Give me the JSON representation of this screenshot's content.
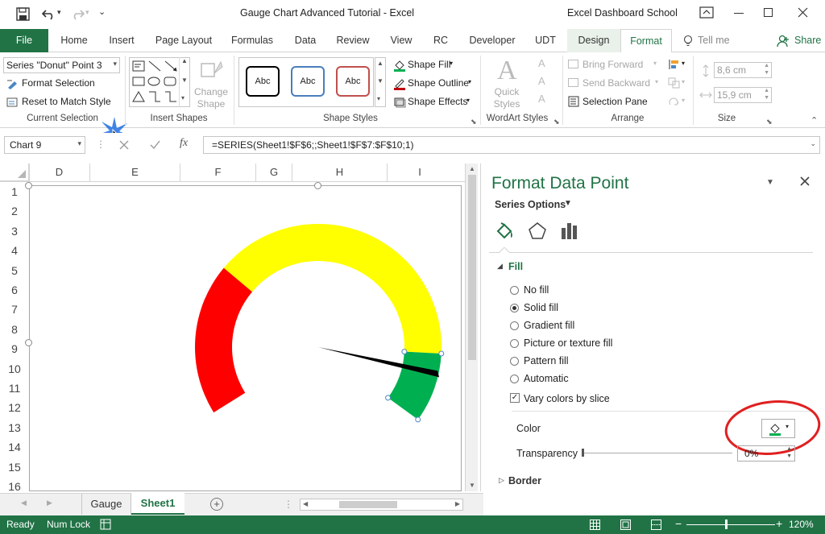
{
  "window": {
    "title": "Gauge Chart Advanced Tutorial  -  Excel",
    "account": "Excel Dashboard School"
  },
  "tabs": {
    "file": "File",
    "home": "Home",
    "insert": "Insert",
    "page_layout": "Page Layout",
    "formulas": "Formulas",
    "data": "Data",
    "review": "Review",
    "view": "View",
    "rc": "RC",
    "developer": "Developer",
    "udt": "UDT",
    "design": "Design",
    "format": "Format",
    "tell_me": "Tell me",
    "share": "Share"
  },
  "ribbon": {
    "current_selection": {
      "dropdown_value": "Series \"Donut\" Point 3",
      "format_selection": "Format Selection",
      "reset": "Reset to Match Style",
      "label": "Current Selection"
    },
    "insert_shapes": {
      "label": "Insert Shapes",
      "change_shape": "Change Shape"
    },
    "shape_styles": {
      "label": "Shape Styles",
      "styles": [
        "Abc",
        "Abc",
        "Abc"
      ],
      "shape_fill": "Shape Fill",
      "shape_outline": "Shape Outline",
      "shape_effects": "Shape Effects"
    },
    "wordart": {
      "label": "WordArt Styles",
      "quick_styles": "Quick Styles"
    },
    "arrange": {
      "label": "Arrange",
      "bring_forward": "Bring Forward",
      "send_backward": "Send Backward",
      "selection_pane": "Selection Pane"
    },
    "size": {
      "label": "Size",
      "height": "8,6 cm",
      "width": "15,9 cm"
    }
  },
  "formula_bar": {
    "name_box": "Chart 9",
    "formula": "=SERIES(Sheet1!$F$6;;Sheet1!$F$7:$F$10;1)"
  },
  "grid": {
    "columns": [
      "D",
      "E",
      "F",
      "G",
      "H",
      "I"
    ],
    "rows": [
      "1",
      "2",
      "3",
      "4",
      "5",
      "6",
      "7",
      "8",
      "9",
      "10",
      "11",
      "12",
      "13",
      "14",
      "15",
      "16"
    ]
  },
  "gauge": {
    "segments": [
      {
        "name": "red",
        "color": "#ff0000"
      },
      {
        "name": "yellow",
        "color": "#ffff00"
      },
      {
        "name": "green",
        "color": "#00b050"
      }
    ],
    "needle_color": "#000000"
  },
  "pane": {
    "title": "Format Data Point",
    "series_options": "Series Options",
    "fill_header": "Fill",
    "fill_options": [
      "No fill",
      "Solid fill",
      "Gradient fill",
      "Picture or texture fill",
      "Pattern fill",
      "Automatic"
    ],
    "selected_fill": "Solid fill",
    "vary_colors": "Vary colors by slice",
    "color_label": "Color",
    "transparency_label": "Transparency",
    "transparency_value": "0%",
    "border_header": "Border",
    "accent_color": "#217346"
  },
  "sheets": {
    "tabs": [
      "Gauge",
      "Sheet1"
    ],
    "active": "Sheet1"
  },
  "status": {
    "ready": "Ready",
    "num_lock": "Num Lock",
    "zoom": "120%"
  }
}
